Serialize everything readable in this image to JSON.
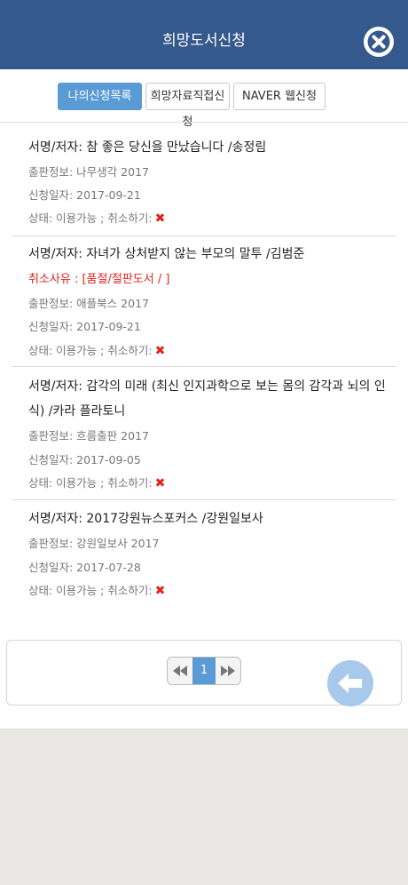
{
  "header": {
    "title": "희망도서신청"
  },
  "tabs": [
    {
      "label": "나의신청목록"
    },
    {
      "label": "희망자료직접신청"
    },
    {
      "label": "NAVER 웹신청"
    }
  ],
  "requests": [
    {
      "title_line1": "서명/저자: 참 좋은 당신을 만났습니다 /송정림",
      "publication": "출판정보: 나무생각 2017",
      "date": "신청일자: 2017-09-21",
      "status": "상태: 이용가능 ; 취소하기:"
    },
    {
      "title_line1": "서명/저자: 자녀가 상처받지 않는 부모의 말투 /김범준",
      "cancel_reason": "취소사유 : [품절/절판도서 / ]",
      "publication": "출판정보: 애플북스 2017",
      "date": "신청일자: 2017-09-21",
      "status": "상태: 이용가능 ; 취소하기:"
    },
    {
      "title_line1": "서명/저자: 감각의 미래 (최신 인지과학으로 보는 몸의 감각과 뇌의 인",
      "title_line2": "식) /카라 플라토니",
      "publication": "출판정보: 흐름출판 2017",
      "date": "신청일자: 2017-09-05",
      "status": "상태: 이용가능 ; 취소하기:"
    },
    {
      "title_line1": "서명/저자: 2017강원뉴스포커스 /강원일보사",
      "publication": "출판정보: 강원일보사 2017",
      "date": "신청일자: 2017-07-28",
      "status": "상태: 이용가능 ; 취소하기:"
    }
  ],
  "icons": {
    "close": "close-circle-icon",
    "cancel": "x-mark-icon",
    "first": "rewind-icon",
    "last": "fast-forward-icon",
    "back": "arrow-left-icon"
  },
  "pagination": {
    "current_page": "1"
  },
  "colors": {
    "header": "#35598c",
    "accent": "#5b9bd5",
    "cancel": "#e0231b",
    "back_button": "#a9c9ec"
  }
}
